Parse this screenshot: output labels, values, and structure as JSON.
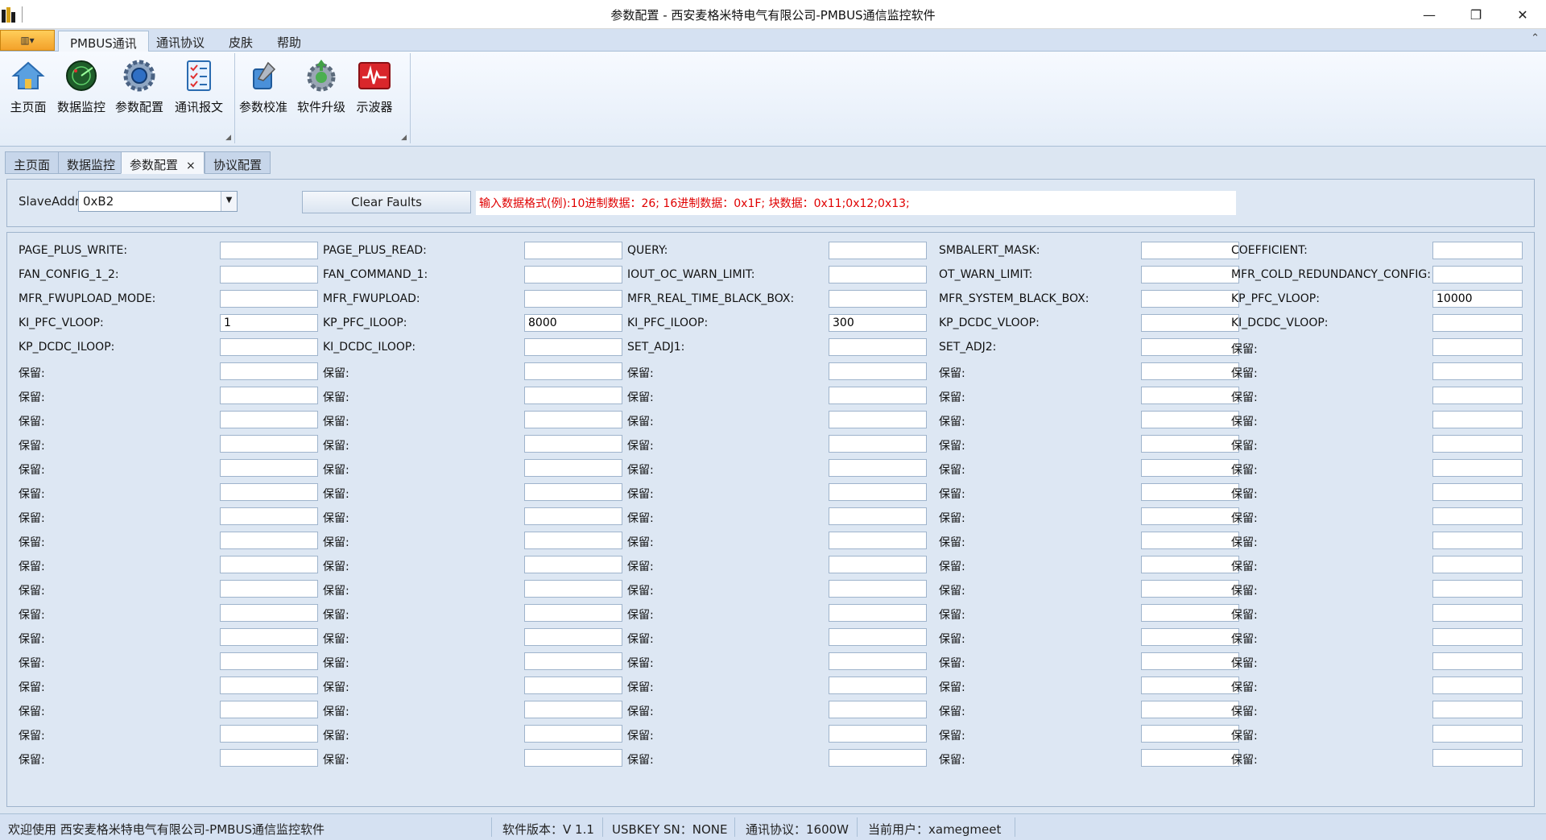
{
  "window": {
    "title": "参数配置 - 西安麦格米特电气有限公司-PMBUS通信监控软件",
    "minimize": "—",
    "restore": "❐",
    "close": "✕"
  },
  "ribbon": {
    "app_menu_label": "▥▾",
    "tabs": [
      "PMBUS通讯",
      "通讯协议",
      "皮肤",
      "帮助"
    ],
    "active_tab": "PMBUS通讯",
    "collapse_glyph": "⌃",
    "group1": [
      "主页面",
      "数据监控",
      "参数配置",
      "通讯报文"
    ],
    "group2": [
      "参数校准",
      "软件升级",
      "示波器"
    ]
  },
  "doc_tabs": [
    "主页面",
    "数据监控",
    "参数配置",
    "协议配置"
  ],
  "doc_tab_close": "×",
  "top": {
    "slave_label": "SlaveAddr:",
    "slave_value": "0xB2",
    "clear_button": "Clear Faults",
    "hint": "输入数据格式(例):10进制数据：26;  16进制数据：0x1F;  块数据：0x11;0x12;0x13;"
  },
  "grid": {
    "columns": 5,
    "rows": [
      [
        [
          "PAGE_PLUS_WRITE:",
          ""
        ],
        [
          "PAGE_PLUS_READ:",
          ""
        ],
        [
          "QUERY:",
          ""
        ],
        [
          "SMBALERT_MASK:",
          ""
        ],
        [
          "COEFFICIENT:",
          ""
        ]
      ],
      [
        [
          "FAN_CONFIG_1_2:",
          ""
        ],
        [
          "FAN_COMMAND_1:",
          ""
        ],
        [
          "IOUT_OC_WARN_LIMIT:",
          ""
        ],
        [
          "OT_WARN_LIMIT:",
          ""
        ],
        [
          "MFR_COLD_REDUNDANCY_CONFIG:",
          ""
        ]
      ],
      [
        [
          "MFR_FWUPLOAD_MODE:",
          ""
        ],
        [
          "MFR_FWUPLOAD:",
          ""
        ],
        [
          "MFR_REAL_TIME_BLACK_BOX:",
          ""
        ],
        [
          "MFR_SYSTEM_BLACK_BOX:",
          ""
        ],
        [
          "KP_PFC_VLOOP:",
          "10000"
        ]
      ],
      [
        [
          "KI_PFC_VLOOP:",
          "1"
        ],
        [
          "KP_PFC_ILOOP:",
          "8000"
        ],
        [
          "KI_PFC_ILOOP:",
          "300"
        ],
        [
          "KP_DCDC_VLOOP:",
          ""
        ],
        [
          "KI_DCDC_VLOOP:",
          ""
        ]
      ],
      [
        [
          "KP_DCDC_ILOOP:",
          ""
        ],
        [
          "KI_DCDC_ILOOP:",
          ""
        ],
        [
          "SET_ADJ1:",
          ""
        ],
        [
          "SET_ADJ2:",
          ""
        ],
        [
          "保留:",
          ""
        ]
      ],
      [
        [
          "保留:",
          ""
        ],
        [
          "保留:",
          ""
        ],
        [
          "保留:",
          ""
        ],
        [
          "保留:",
          ""
        ],
        [
          "保留:",
          ""
        ]
      ],
      [
        [
          "保留:",
          ""
        ],
        [
          "保留:",
          ""
        ],
        [
          "保留:",
          ""
        ],
        [
          "保留:",
          ""
        ],
        [
          "保留:",
          ""
        ]
      ],
      [
        [
          "保留:",
          ""
        ],
        [
          "保留:",
          ""
        ],
        [
          "保留:",
          ""
        ],
        [
          "保留:",
          ""
        ],
        [
          "保留:",
          ""
        ]
      ],
      [
        [
          "保留:",
          ""
        ],
        [
          "保留:",
          ""
        ],
        [
          "保留:",
          ""
        ],
        [
          "保留:",
          ""
        ],
        [
          "保留:",
          ""
        ]
      ],
      [
        [
          "保留:",
          ""
        ],
        [
          "保留:",
          ""
        ],
        [
          "保留:",
          ""
        ],
        [
          "保留:",
          ""
        ],
        [
          "保留:",
          ""
        ]
      ],
      [
        [
          "保留:",
          ""
        ],
        [
          "保留:",
          ""
        ],
        [
          "保留:",
          ""
        ],
        [
          "保留:",
          ""
        ],
        [
          "保留:",
          ""
        ]
      ],
      [
        [
          "保留:",
          ""
        ],
        [
          "保留:",
          ""
        ],
        [
          "保留:",
          ""
        ],
        [
          "保留:",
          ""
        ],
        [
          "保留:",
          ""
        ]
      ],
      [
        [
          "保留:",
          ""
        ],
        [
          "保留:",
          ""
        ],
        [
          "保留:",
          ""
        ],
        [
          "保留:",
          ""
        ],
        [
          "保留:",
          ""
        ]
      ],
      [
        [
          "保留:",
          ""
        ],
        [
          "保留:",
          ""
        ],
        [
          "保留:",
          ""
        ],
        [
          "保留:",
          ""
        ],
        [
          "保留:",
          ""
        ]
      ],
      [
        [
          "保留:",
          ""
        ],
        [
          "保留:",
          ""
        ],
        [
          "保留:",
          ""
        ],
        [
          "保留:",
          ""
        ],
        [
          "保留:",
          ""
        ]
      ],
      [
        [
          "保留:",
          ""
        ],
        [
          "保留:",
          ""
        ],
        [
          "保留:",
          ""
        ],
        [
          "保留:",
          ""
        ],
        [
          "保留:",
          ""
        ]
      ],
      [
        [
          "保留:",
          ""
        ],
        [
          "保留:",
          ""
        ],
        [
          "保留:",
          ""
        ],
        [
          "保留:",
          ""
        ],
        [
          "保留:",
          ""
        ]
      ],
      [
        [
          "保留:",
          ""
        ],
        [
          "保留:",
          ""
        ],
        [
          "保留:",
          ""
        ],
        [
          "保留:",
          ""
        ],
        [
          "保留:",
          ""
        ]
      ],
      [
        [
          "保留:",
          ""
        ],
        [
          "保留:",
          ""
        ],
        [
          "保留:",
          ""
        ],
        [
          "保留:",
          ""
        ],
        [
          "保留:",
          ""
        ]
      ],
      [
        [
          "保留:",
          ""
        ],
        [
          "保留:",
          ""
        ],
        [
          "保留:",
          ""
        ],
        [
          "保留:",
          ""
        ],
        [
          "保留:",
          ""
        ]
      ],
      [
        [
          "保留:",
          ""
        ],
        [
          "保留:",
          ""
        ],
        [
          "保留:",
          ""
        ],
        [
          "保留:",
          ""
        ],
        [
          "保留:",
          ""
        ]
      ],
      [
        [
          "保留:",
          ""
        ],
        [
          "保留:",
          ""
        ],
        [
          "保留:",
          ""
        ],
        [
          "保留:",
          ""
        ],
        [
          "保留:",
          ""
        ]
      ]
    ]
  },
  "status": {
    "welcome": "欢迎使用 西安麦格米特电气有限公司-PMBUS通信监控软件",
    "version": "软件版本：V 1.1",
    "usbkey": "USBKEY SN：NONE",
    "protocol": "通讯协议：1600W",
    "user": "当前用户：xamegmeet"
  },
  "colors": {
    "hint_text": "#e00000",
    "app_menu": "#f3a12a",
    "panel_bg": "#dde7f3"
  }
}
